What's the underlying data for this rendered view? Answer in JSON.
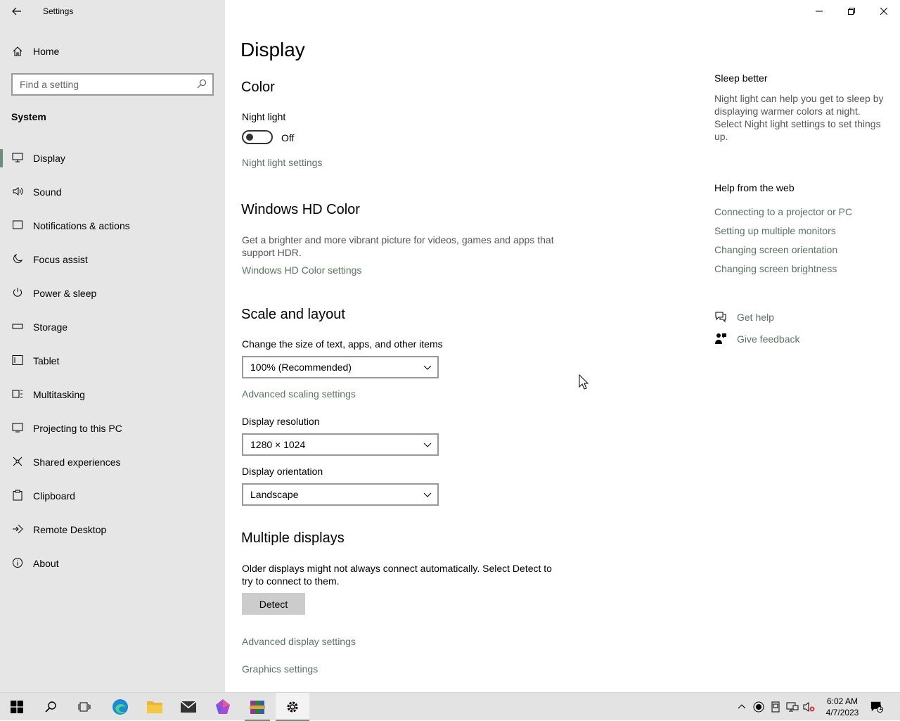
{
  "window": {
    "app_title": "Settings"
  },
  "sidebar": {
    "home_label": "Home",
    "search_placeholder": "Find a setting",
    "section_label": "System",
    "items": [
      {
        "label": "Display",
        "icon": "monitor-icon"
      },
      {
        "label": "Sound",
        "icon": "speaker-icon"
      },
      {
        "label": "Notifications & actions",
        "icon": "message-icon"
      },
      {
        "label": "Focus assist",
        "icon": "moon-icon"
      },
      {
        "label": "Power & sleep",
        "icon": "power-icon"
      },
      {
        "label": "Storage",
        "icon": "storage-icon"
      },
      {
        "label": "Tablet",
        "icon": "tablet-icon"
      },
      {
        "label": "Multitasking",
        "icon": "multitasking-icon"
      },
      {
        "label": "Projecting to this PC",
        "icon": "projector-icon"
      },
      {
        "label": "Shared experiences",
        "icon": "shared-icon"
      },
      {
        "label": "Clipboard",
        "icon": "clipboard-icon"
      },
      {
        "label": "Remote Desktop",
        "icon": "remote-desktop-icon"
      },
      {
        "label": "About",
        "icon": "info-icon"
      }
    ],
    "selected": "Display"
  },
  "main": {
    "title": "Display",
    "color": {
      "heading": "Color",
      "night_light_label": "Night light",
      "night_light_state": "Off",
      "night_light_link": "Night light settings"
    },
    "hd_color": {
      "heading": "Windows HD Color",
      "description": "Get a brighter and more vibrant picture for videos, games and apps that support HDR.",
      "link": "Windows HD Color settings"
    },
    "scale": {
      "heading": "Scale and layout",
      "size_label": "Change the size of text, apps, and other items",
      "size_value": "100% (Recommended)",
      "advanced_link": "Advanced scaling settings",
      "resolution_label": "Display resolution",
      "resolution_value": "1280 × 1024",
      "orientation_label": "Display orientation",
      "orientation_value": "Landscape"
    },
    "multiple": {
      "heading": "Multiple displays",
      "description": "Older displays might not always connect automatically. Select Detect to try to connect to them.",
      "detect_button": "Detect",
      "advanced_display_link": "Advanced display settings",
      "graphics_link": "Graphics settings"
    }
  },
  "right_panel": {
    "sleep_heading": "Sleep better",
    "sleep_desc": "Night light can help you get to sleep by displaying warmer colors at night. Select Night light settings to set things up.",
    "help_heading": "Help from the web",
    "help_links": [
      "Connecting to a projector or PC",
      "Setting up multiple monitors",
      "Changing screen orientation",
      "Changing screen brightness"
    ],
    "get_help": "Get help",
    "give_feedback": "Give feedback"
  },
  "taskbar": {
    "time": "6:02 AM",
    "date": "4/7/2023",
    "notification_count": "1",
    "apps": [
      "start-icon",
      "search-icon",
      "task-view-icon",
      "edge-icon",
      "file-explorer-icon",
      "mail-icon",
      "app-icon",
      "winrar-icon",
      "settings-icon"
    ]
  },
  "colors": {
    "accent": "#6a8f7a",
    "link": "#5a7463",
    "sidebar_bg": "#e6e6e6",
    "taskbar_bg": "#e3e3e3"
  }
}
